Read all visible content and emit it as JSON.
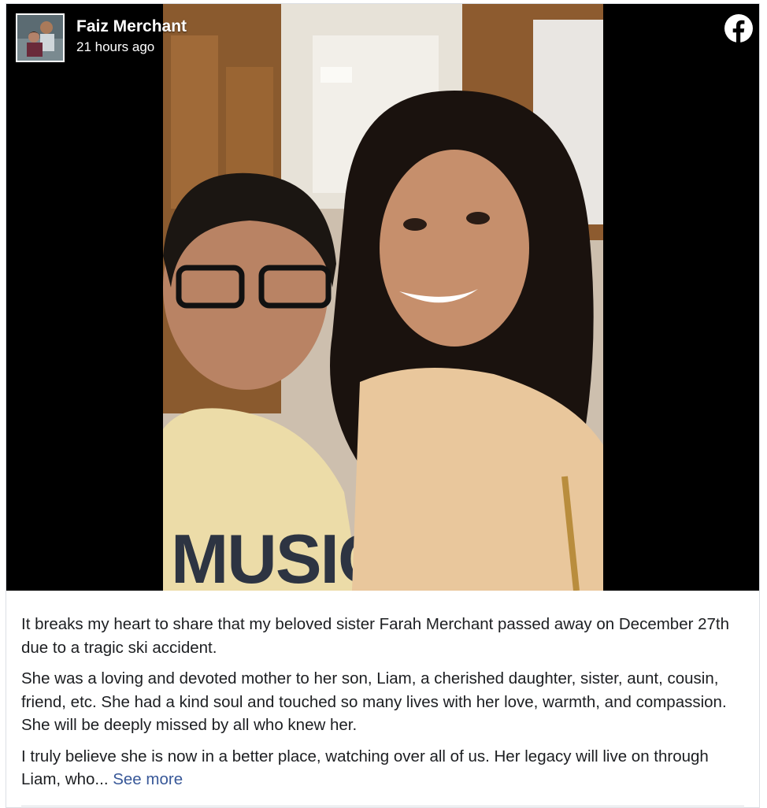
{
  "post": {
    "author": "Faiz Merchant",
    "time": "21 hours ago",
    "brand_icon": "facebook-icon",
    "paragraphs": [
      "It breaks my heart to share that my beloved sister Farah Merchant passed away on December 27th due to a tragic ski accident.",
      "She was a loving and devoted mother to her son, Liam, a cherished daughter, sister, aunt, cousin, friend, etc. She had a kind soul and touched so many lives with her love, warmth, and compassion. She will be deeply missed by all who knew her."
    ],
    "last_paragraph": "I truly believe she is now in a better place, watching over all of us. Her legacy will live on through Liam, who...",
    "see_more": "See more",
    "shirt_text": "MUSIC"
  },
  "colors": {
    "link": "#385898",
    "text": "#1c1e21",
    "media_bg": "#000000"
  }
}
